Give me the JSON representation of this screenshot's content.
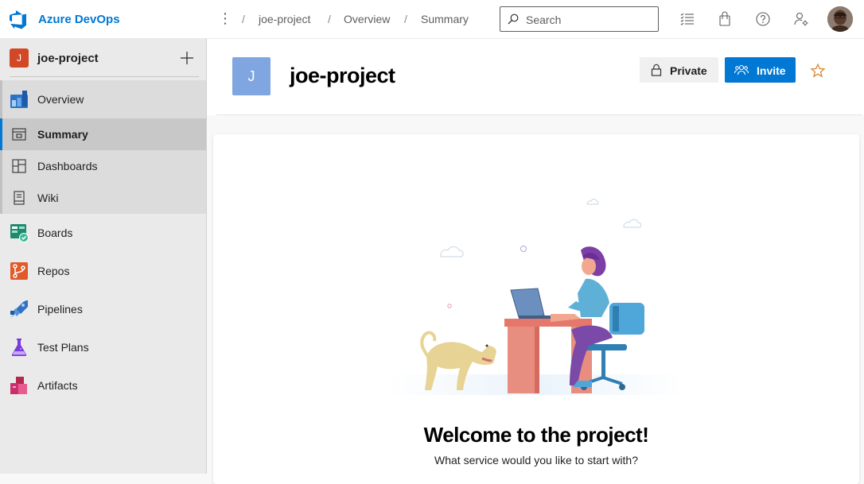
{
  "app": {
    "brand": "Azure DevOps"
  },
  "breadcrumb": {
    "items": [
      "joe-project",
      "Overview",
      "Summary"
    ],
    "separator": "/"
  },
  "search": {
    "placeholder": "Search"
  },
  "header_icons": [
    "task-list-icon",
    "shopping-bag-icon",
    "help-icon",
    "user-settings-icon"
  ],
  "sidebar": {
    "project_initial": "J",
    "project_name": "joe-project",
    "items": [
      {
        "label": "Overview",
        "icon": "overview-icon"
      },
      {
        "label": "Summary",
        "icon": "summary-icon",
        "selected": true
      },
      {
        "label": "Dashboards",
        "icon": "dashboards-icon"
      },
      {
        "label": "Wiki",
        "icon": "wiki-icon"
      },
      {
        "label": "Boards",
        "icon": "boards-icon"
      },
      {
        "label": "Repos",
        "icon": "repos-icon"
      },
      {
        "label": "Pipelines",
        "icon": "pipelines-icon"
      },
      {
        "label": "Test Plans",
        "icon": "test-plans-icon"
      },
      {
        "label": "Artifacts",
        "icon": "artifacts-icon"
      }
    ]
  },
  "main": {
    "project_initial": "J",
    "title": "joe-project",
    "private_label": "Private",
    "invite_label": "Invite",
    "welcome_title": "Welcome to the project!",
    "welcome_subtitle": "What service would you like to start with?"
  },
  "colors": {
    "accent": "#0078d4",
    "project_badge": "#d24726",
    "project_tile": "#7fa6e0",
    "favorite_star": "#d9822b"
  }
}
